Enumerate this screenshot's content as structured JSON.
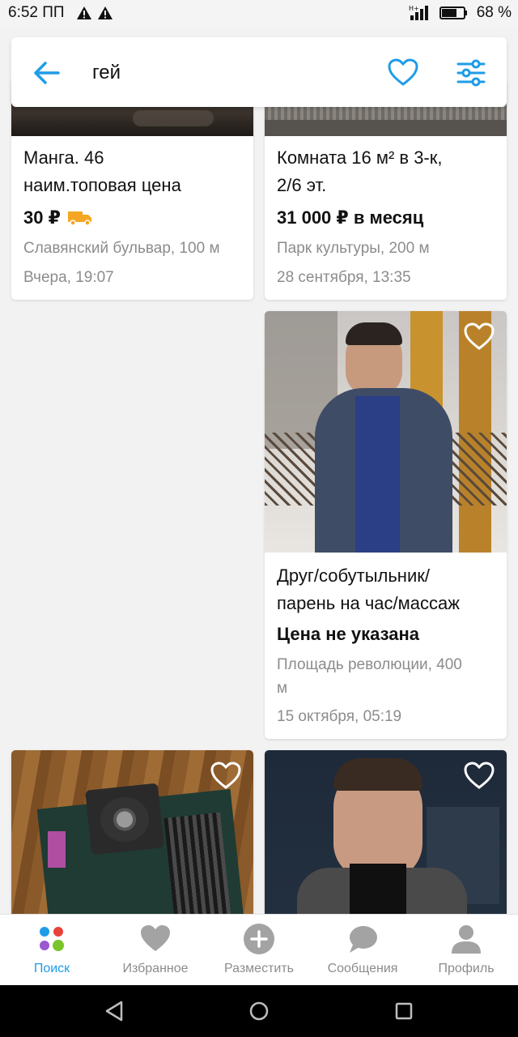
{
  "status_bar": {
    "time": "6:52 ПП",
    "battery": "68 %"
  },
  "search": {
    "query": "гей"
  },
  "listings": [
    {
      "title_line1": "Манга. 46",
      "title_line2": "наим.топовая цена",
      "price": "30 ₽",
      "location": "Славянский бульвар, 100 м",
      "date": "Вчера, 19:07",
      "delivery": true
    },
    {
      "title_line1": "Комната 16 м² в 3-к,",
      "title_line2": "2/6 эт.",
      "price": "31 000 ₽ в месяц",
      "location": "Парк культуры, 200 м",
      "date": "28 сентября, 13:35"
    },
    {
      "title_line1": "Друг/собутыльник/",
      "title_line2": "парень на час/массаж",
      "price": "Цена не указана",
      "location_line1": "Площадь революции, 400",
      "location_line2": "м",
      "date": "15 октября, 05:19"
    }
  ],
  "bottom_nav": [
    {
      "label": "Поиск",
      "icon": "dots-icon",
      "active": true
    },
    {
      "label": "Избранное",
      "icon": "heart-icon"
    },
    {
      "label": "Разместить",
      "icon": "plus-circle-icon"
    },
    {
      "label": "Сообщения",
      "icon": "chat-bubble-icon"
    },
    {
      "label": "Профиль",
      "icon": "person-icon"
    }
  ],
  "colors": {
    "accent": "#1f9ce8",
    "delivery": "#f5a623",
    "muted": "#8c8c8c"
  }
}
